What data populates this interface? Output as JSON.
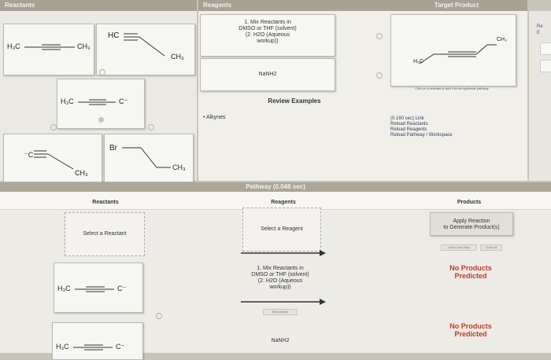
{
  "headers": {
    "reactants": "Reactants",
    "reagents": "Reagents",
    "target_product": "Target Product",
    "pathway": "Pathway (0.048 sec)"
  },
  "reagent_cards": {
    "card1": {
      "line1": "1. Mix Reactants in",
      "line2": "DMSO or THF (solvent)",
      "line3": "(2. H2O (Aqueous",
      "line4": "workup))"
    },
    "card2": "NaNH2"
  },
  "review_examples": "Review Examples",
  "alkynes_bullet": "Alkynes",
  "target_hint": "Click on a reactant to add it to the synthesis pathway",
  "links": {
    "timing": "(0.160 sec) Link",
    "reload_reactants": "Reload Reactants",
    "reload_reagents": "Reload Reagents",
    "reload_pathway": "Reload Pathway / Workspace"
  },
  "right_edge": {
    "line1": "Re",
    "line2": "E"
  },
  "molecules": {
    "propyne_left": {
      "h3c": "H₃C",
      "ch3": "CH₃"
    },
    "acetylene": {
      "hc": "HC"
    },
    "propynide": {
      "h3c": "H₃C",
      "c": "C⁻"
    },
    "acetylide": {
      "c": "⁻C"
    },
    "bromide": {
      "br": "Br",
      "ch3": "CH₃"
    },
    "ethyl": {
      "ch3": "CH₃"
    },
    "target": {
      "h3c": "H₃C",
      "ch3": "CH₃"
    },
    "path1": {
      "h3c": "H₃C",
      "c": "C⁻"
    },
    "path2": {
      "h3c": "H₃C",
      "c": "C⁻"
    }
  },
  "pathway": {
    "col_reactants": "Reactants",
    "col_reagents": "Reagents",
    "col_products": "Products",
    "select_reactant": "Select a Reactant",
    "select_reagent": "Select a Reagent",
    "apply_line1": "Apply Reaction",
    "apply_line2": "to Generate Product(s)",
    "undo_last_step": "Undo Last Step",
    "clear_all": "Clear All",
    "step1": {
      "line1": "1. Mix Reactants in",
      "line2": "DMSO or THF (solvent)",
      "line3": "(2. H2O (Aqueous",
      "line4": "workup))"
    },
    "mechanism": "Mechanism",
    "step2_reagent": "NaNH2",
    "no_products_1": {
      "line1": "No Products",
      "line2": "Predicted"
    },
    "no_products_2": {
      "line1": "No Products",
      "line2": "Predicted"
    }
  }
}
